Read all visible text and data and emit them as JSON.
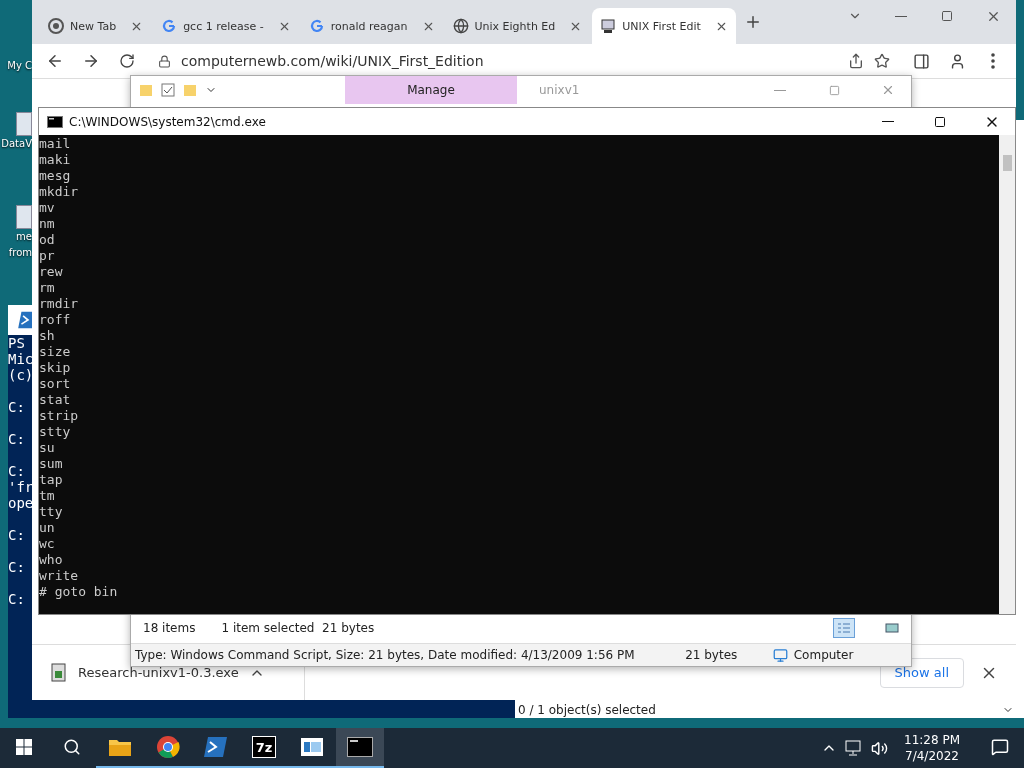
{
  "desktop_icons": [
    {
      "lines": [
        "My C"
      ]
    },
    {
      "lines": [
        "DataV"
      ]
    },
    {
      "lines": [
        "me",
        "from"
      ]
    }
  ],
  "powershell_window": {
    "lines": [
      {
        "kind": "text",
        "text": "PS"
      },
      {
        "kind": "text",
        "text": "Mic"
      },
      {
        "kind": "text",
        "text": "(c)"
      },
      {
        "kind": "prompt",
        "text": "C:"
      },
      {
        "kind": "prompt",
        "text": "C:"
      },
      {
        "kind": "prompt",
        "text": "C:"
      },
      {
        "kind": "text",
        "text": "'fr"
      },
      {
        "kind": "text",
        "text": "ope"
      },
      {
        "kind": "prompt",
        "text": "C:"
      },
      {
        "kind": "prompt",
        "text": "C:"
      },
      {
        "kind": "prompt",
        "text": "C:"
      }
    ]
  },
  "back_window": {
    "status": "0 / 1 object(s) selected"
  },
  "browser": {
    "tabs": [
      {
        "title": "New Tab",
        "kind": "chrome",
        "selected": false
      },
      {
        "title": "gcc 1 release -",
        "kind": "google",
        "selected": false
      },
      {
        "title": "ronald reagan",
        "kind": "google",
        "selected": false
      },
      {
        "title": "Unix Eighth Ed",
        "kind": "globe",
        "selected": false
      },
      {
        "title": "UNIX First Edit",
        "kind": "computer",
        "selected": true
      }
    ],
    "address": "computernewb.com/wiki/UNIX_First_Edition",
    "download": {
      "file": "Research-unixv1-0.3.exe",
      "button": "Show all"
    }
  },
  "explorer": {
    "ribbon_tab": "Manage",
    "title": "unixv1",
    "item_count": "18 items",
    "selection": "1 item selected  21 bytes",
    "details": "Type: Windows Command Script, Size: 21 bytes, Date modified: 4/13/2009 1:56 PM",
    "size": "21 bytes",
    "location": "Computer"
  },
  "cmd": {
    "title": "C:\\WINDOWS\\system32\\cmd.exe",
    "lines": [
      "mail",
      "maki",
      "mesg",
      "mkdir",
      "mv",
      "nm",
      "od",
      "pr",
      "rew",
      "rm",
      "rmdir",
      "roff",
      "sh",
      "size",
      "skip",
      "sort",
      "stat",
      "strip",
      "stty",
      "su",
      "sum",
      "tap",
      "tm",
      "tty",
      "un",
      "wc",
      "who",
      "write",
      "# goto bin"
    ]
  },
  "taskbar": {
    "apps": [
      {
        "kind": "explorer",
        "running": true,
        "selected": false
      },
      {
        "kind": "chrome",
        "running": true,
        "selected": false
      },
      {
        "kind": "powershell",
        "running": true,
        "selected": false
      },
      {
        "kind": "sevenzip",
        "label": "7z",
        "running": true,
        "selected": false
      },
      {
        "kind": "window",
        "running": true,
        "selected": false
      },
      {
        "kind": "console",
        "running": true,
        "selected": true
      }
    ],
    "time": "11:28 PM",
    "date": "7/4/2022"
  }
}
